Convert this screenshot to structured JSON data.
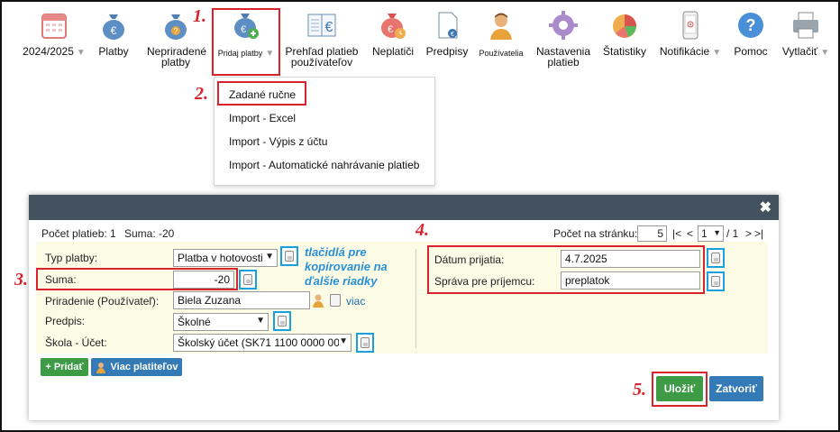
{
  "toolbar": {
    "items": [
      {
        "label": "2024/2025",
        "icon": "calendar-icon",
        "has_caret": true
      },
      {
        "label": "Platby",
        "icon": "money-bag-euro-icon"
      },
      {
        "label": "Nepriradené",
        "label2": "platby",
        "icon": "money-bag-question-icon"
      },
      {
        "label": "Pridaj platby",
        "icon": "money-bag-add-icon",
        "has_caret": true
      },
      {
        "label": "Prehľad platieb",
        "label2": "používateľov",
        "icon": "ledger-euro-icon"
      },
      {
        "label": "Neplatiči",
        "icon": "money-bag-clock-icon"
      },
      {
        "label": "Predpisy",
        "icon": "document-euro-icon"
      },
      {
        "label": "Používatelia",
        "icon": "user-icon"
      },
      {
        "label": "Nastavenia",
        "label2": "platieb",
        "icon": "gear-icon"
      },
      {
        "label": "Štatistiky",
        "icon": "pie-chart-icon"
      },
      {
        "label": "Notifikácie",
        "icon": "phone-notification-icon",
        "has_caret": true
      },
      {
        "label": "Pomoc",
        "icon": "help-icon"
      },
      {
        "label": "Vytlačiť",
        "icon": "printer-icon",
        "has_caret": true
      }
    ]
  },
  "steps": {
    "s1": "1.",
    "s2": "2.",
    "s3": "3.",
    "s4": "4.",
    "s5": "5."
  },
  "dropdown": {
    "items": [
      "Zadané ručne",
      "Import - Excel",
      "Import - Výpis z účtu",
      "Import - Automatické nahrávanie platieb"
    ]
  },
  "dialog": {
    "close": "✖",
    "summary": {
      "count_label": "Počet platieb: 1",
      "sum_label": "Suma: -20"
    },
    "pager": {
      "per_page_label": "Počet na stránku:",
      "per_page_value": "5",
      "first": "|<",
      "prev": "<",
      "page": "1",
      "of": "/ 1",
      "next": ">",
      "last": ">|"
    },
    "hint": "tlačidlá pre kopírovanie na ďalšie riadky",
    "fields": {
      "typ_platby": {
        "label": "Typ platby:",
        "value": "Platba v hotovosti"
      },
      "suma": {
        "label": "Suma:",
        "value": "-20"
      },
      "priradenie": {
        "label": "Priradenie (Používateľ):",
        "value": "Biela Zuzana",
        "more": "viac"
      },
      "predpis": {
        "label": "Predpis:",
        "value": "Školné"
      },
      "skola_ucet": {
        "label": "Škola - Účet:",
        "value": "Školský účet (SK71 1100 0000 00"
      },
      "datum": {
        "label": "Dátum prijatia:",
        "value": "4.7.2025"
      },
      "sprava": {
        "label": "Správa pre príjemcu:",
        "value": "preplatok"
      }
    },
    "buttons": {
      "add": "+ Pridať",
      "more_payers": "Viac platiteľov",
      "save": "Uložiť",
      "close": "Zatvoriť"
    }
  },
  "colors": {
    "highlight": "#d9232d",
    "copy_border": "#1a9fe0",
    "save": "#3d9b45",
    "close": "#337ab7",
    "header": "#44525f",
    "panel": "#fcfbe6"
  }
}
